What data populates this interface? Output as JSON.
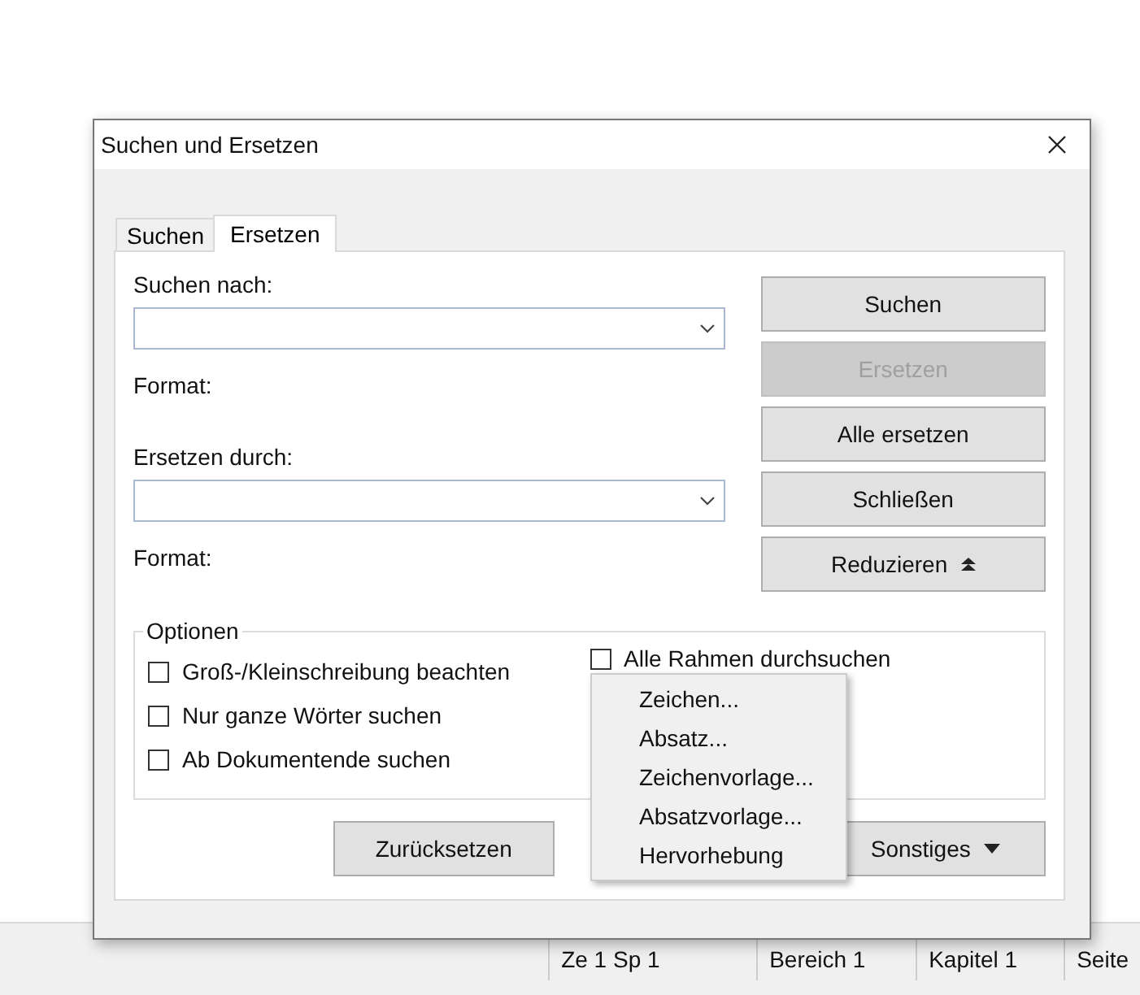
{
  "window": {
    "title": "Suchen und Ersetzen"
  },
  "tabs": [
    {
      "label": "Suchen",
      "selected": false
    },
    {
      "label": "Ersetzen",
      "selected": true
    }
  ],
  "search": {
    "label": "Suchen nach:",
    "format": "Format:"
  },
  "replace": {
    "label": "Ersetzen durch:",
    "format": "Format:"
  },
  "side_buttons": [
    {
      "label": "Suchen",
      "disabled": false
    },
    {
      "label": "Ersetzen",
      "disabled": true
    },
    {
      "label": "Alle ersetzen",
      "disabled": false
    },
    {
      "label": "Schließen",
      "disabled": false
    },
    {
      "label": "Reduzieren",
      "disabled": false
    }
  ],
  "options": {
    "title": "Optionen",
    "left": [
      {
        "label": "Groß-/Kleinschreibung beachten",
        "checked": false
      },
      {
        "label": "Nur ganze Wörter suchen",
        "checked": false
      },
      {
        "label": "Ab Dokumentende suchen",
        "checked": false
      }
    ],
    "right": [
      {
        "label": "Alle Rahmen durchsuchen",
        "checked": false
      }
    ]
  },
  "bottom_buttons": [
    {
      "label": "Zurücksetzen"
    },
    {
      "label": "Sonstiges"
    }
  ],
  "menu": [
    "Zeichen...",
    "Absatz...",
    "Zeichenvorlage...",
    "Absatzvorlage...",
    "Hervorhebung"
  ],
  "status_bar": [
    "Ze 1 Sp 1",
    "Bereich 1",
    "Kapitel 1",
    "Seite"
  ]
}
